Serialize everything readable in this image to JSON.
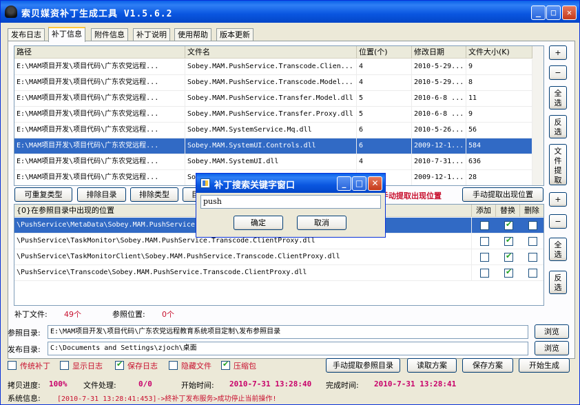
{
  "window": {
    "title": "索贝媒资补丁生成工具  V1.5.6.2",
    "min_symbol": "_",
    "max_symbol": "□",
    "close_symbol": "✕"
  },
  "tabs": [
    "发布日志",
    "补丁信息",
    "附件信息",
    "补丁说明",
    "使用帮助",
    "版本更新"
  ],
  "file_grid": {
    "headers": [
      "路径",
      "文件名",
      "位置(个)",
      "修改日期",
      "文件大小(K)"
    ],
    "rows": [
      [
        "E:\\MAM项目开发\\项目代码\\广东农党远程...",
        "Sobey.MAM.PushService.Transcode.Clien...",
        "4",
        "2010-5-29...",
        "9"
      ],
      [
        "E:\\MAM项目开发\\项目代码\\广东农党远程...",
        "Sobey.MAM.PushService.Transcode.Model...",
        "4",
        "2010-5-29...",
        "8"
      ],
      [
        "E:\\MAM项目开发\\项目代码\\广东农党远程...",
        "Sobey.MAM.PushService.Transfer.Model.dll",
        "5",
        "2010-6-8 ...",
        "11"
      ],
      [
        "E:\\MAM项目开发\\项目代码\\广东农党远程...",
        "Sobey.MAM.PushService.Transfer.Proxy.dll",
        "5",
        "2010-6-8 ...",
        "9"
      ],
      [
        "E:\\MAM项目开发\\项目代码\\广东农党远程...",
        "Sobey.MAM.SystemService.Mq.dll",
        "6",
        "2010-5-26...",
        "56"
      ],
      [
        "E:\\MAM项目开发\\项目代码\\广东农党远程...",
        "Sobey.MAM.SystemUI.Controls.dll",
        "6",
        "2009-12-1...",
        "584"
      ],
      [
        "E:\\MAM项目开发\\项目代码\\广东农党远程...",
        "Sobey.MAM.SystemUI.dll",
        "4",
        "2010-7-31...",
        "636"
      ],
      [
        "E:\\MAM项目开发\\项目代码\\广东农党远程...",
        "So",
        "",
        "2009-12-1...",
        "28"
      ]
    ]
  },
  "side_top": {
    "add": "+",
    "remove": "−",
    "select_all": "全选",
    "invert": "反选",
    "file_extract": "文件提取"
  },
  "toolbar": {
    "repeatable_type": "可重复类型",
    "exclude_dir": "排除目录",
    "exclude_type": "排除类型",
    "hidden_partial": "目",
    "manual_extract_red": "手动提取出现位置",
    "manual_extract": "手动提取出现位置"
  },
  "side_bottom": {
    "add": "+",
    "remove": "−",
    "select_all": "全选",
    "invert": "反选"
  },
  "loc_grid": {
    "headers": [
      "{0}在参照目录中出现的位置",
      "添加",
      "替换",
      "删除"
    ],
    "rows": [
      {
        "path": "\\PushService\\MetaData\\Sobey.MAM.PushService",
        "add": false,
        "replace": true,
        "del": false
      },
      {
        "path": "\\PushService\\TaskMonitor\\Sobey.MAM.PushService.Transcode.ClientProxy.dll",
        "add": false,
        "replace": true,
        "del": false
      },
      {
        "path": "\\PushService\\TaskMonitorClient\\Sobey.MAM.PushService.Transcode.ClientProxy.dll",
        "add": false,
        "replace": true,
        "del": false
      },
      {
        "path": "\\PushService\\Transcode\\Sobey.MAM.PushService.Transcode.ClientProxy.dll",
        "add": false,
        "replace": true,
        "del": false
      }
    ]
  },
  "counts": {
    "patch_label": "补丁文件:",
    "patch_value": "49个",
    "ref_label": "参照位置:",
    "ref_value": "0个"
  },
  "ref_dir": {
    "label": "参照目录:",
    "value": "E:\\MAM项目开发\\项目代码\\广东农党远程教育系统项目定制\\发布参照目录",
    "browse": "浏览"
  },
  "pub_dir": {
    "label": "发布目录:",
    "value": "C:\\Documents and Settings\\zjoch\\桌面",
    "browse": "浏览"
  },
  "options": [
    {
      "label": "传统补丁",
      "checked": false
    },
    {
      "label": "显示日志",
      "checked": false
    },
    {
      "label": "保存日志",
      "checked": true
    },
    {
      "label": "隐藏文件",
      "checked": false
    },
    {
      "label": "压缩包",
      "checked": true
    }
  ],
  "actions": {
    "manual_ref": "手动提取参照目录",
    "read_plan": "读取方案",
    "save_plan": "保存方案",
    "generate": "开始生成"
  },
  "status": {
    "copy_label": "拷贝进度:",
    "copy_value": "100%",
    "proc_label": "文件处理:",
    "proc_value": "0/0",
    "start_label": "开始时间:",
    "start_value": "2010-7-31  13:28:40",
    "end_label": "完成时间:",
    "end_value": "2010-7-31  13:28:41",
    "sys_label": "系统信息:",
    "sys_value": "[2010-7-31 13:28:41:453]->終补丁发布服务>成功停止当前操作!"
  },
  "dialog": {
    "title": "补丁搜索关键字窗口",
    "input_value": "push",
    "ok": "确定",
    "cancel": "取消"
  }
}
